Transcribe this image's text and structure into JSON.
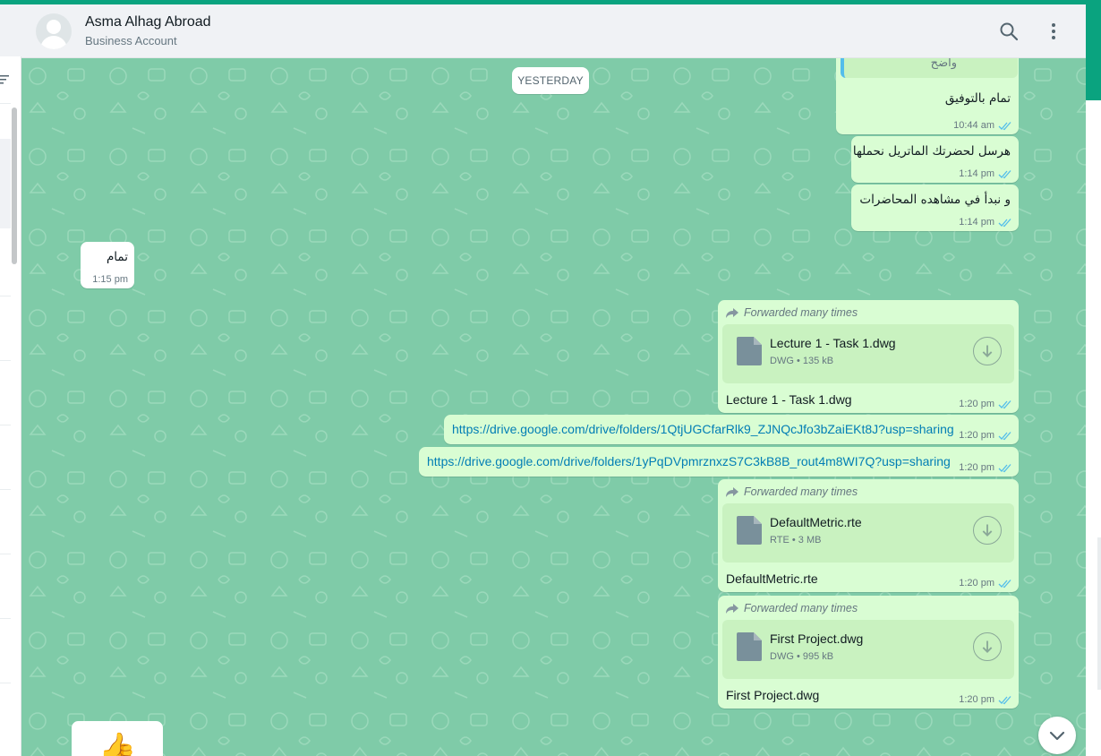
{
  "contact": {
    "name": "Asma Alhag Abroad",
    "subtitle": "Business Account"
  },
  "date_divider": "YESTERDAY",
  "messages": {
    "quoted": {
      "text": "واضح"
    },
    "m1": {
      "text": "تمام بالتوفيق",
      "time": "10:44 am"
    },
    "m2": {
      "text": "هرسل لحضرتك الماتريل نحملها",
      "time": "1:14 pm"
    },
    "m3": {
      "text": "و نبدأ في مشاهده المحاضرات",
      "time": "1:14 pm"
    },
    "m4": {
      "text": "تمام",
      "time": "1:15 pm"
    },
    "doc1": {
      "forwarded_label": "Forwarded many times",
      "file_name": "Lecture 1 - Task 1.dwg",
      "file_meta": "DWG • 135 kB",
      "caption": "Lecture 1 - Task 1.dwg",
      "time": "1:20 pm"
    },
    "link1": {
      "url": "https://drive.google.com/drive/folders/1QtjUGCfarRlk9_ZJNQcJfo3bZaiEKt8J?usp=sharing",
      "time": "1:20 pm"
    },
    "link2": {
      "url": "https://drive.google.com/drive/folders/1yPqDVpmrznxzS7C3kB8B_rout4m8WI7Q?usp=sharing",
      "time": "1:20 pm"
    },
    "doc2": {
      "forwarded_label": "Forwarded many times",
      "file_name": "DefaultMetric.rte",
      "file_meta": "RTE • 3 MB",
      "caption": "DefaultMetric.rte",
      "time": "1:20 pm"
    },
    "doc3": {
      "forwarded_label": "Forwarded many times",
      "file_name": "First Project.dwg",
      "file_meta": "DWG • 995 kB",
      "caption": "First Project.dwg",
      "time": "1:20 pm"
    },
    "sticker": {
      "emoji": "👍"
    }
  },
  "icons": {
    "search": "search-icon",
    "menu": "menu-icon",
    "scroll_down": "chevron-down-icon",
    "forwarded": "forwarded-icon",
    "file": "file-icon",
    "download": "download-icon",
    "read": "double-check-icon",
    "filter": "filter-icon"
  },
  "colors": {
    "accent": "#0aa37f",
    "chat_bg": "#7fcba8",
    "out_bubble": "#d9fdd3",
    "link": "#027eb5",
    "read_tick": "#53bdeb"
  }
}
